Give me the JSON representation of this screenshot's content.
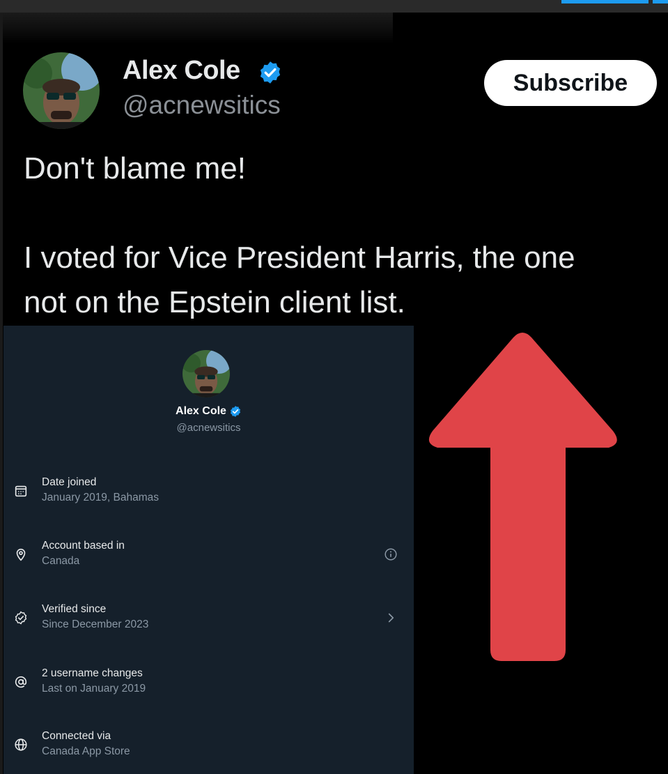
{
  "tweet": {
    "author_name": "Alex Cole",
    "author_handle": "@acnewsitics",
    "subscribe_label": "Subscribe",
    "text_line1": "Don't blame me!",
    "text_line2": "I voted for Vice President Harris, the one",
    "text_line3": "not on the Epstein client list."
  },
  "profile_panel": {
    "name": "Alex Cole",
    "handle": "@acnewsitics",
    "rows": [
      {
        "icon": "calendar-icon",
        "label": "Date joined",
        "value": "January 2019, Bahamas"
      },
      {
        "icon": "location-pin-icon",
        "label": "Account based in",
        "value": "Canada",
        "trailing_icon": "info-icon"
      },
      {
        "icon": "verified-check-icon",
        "label": "Verified since",
        "value": "Since December 2023",
        "trailing_icon": "chevron-right-icon"
      },
      {
        "icon": "at-sign-icon",
        "label": "2 username changes",
        "value": "Last on January 2019"
      },
      {
        "icon": "globe-icon",
        "label": "Connected via",
        "value": "Canada App Store"
      }
    ]
  },
  "colors": {
    "background": "#000000",
    "panel_background": "#15202b",
    "verified_blue": "#1d9bf0",
    "arrow_red": "#e04448",
    "muted_text": "#8b98a5"
  }
}
